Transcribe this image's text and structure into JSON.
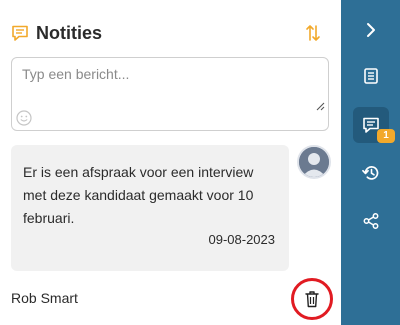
{
  "header": {
    "title": "Notities",
    "title_icon": "note-icon",
    "sort_icon": "sort-arrows-icon"
  },
  "compose": {
    "placeholder": "Typ een bericht...",
    "value": "",
    "emoji_icon": "smiley-icon"
  },
  "notes": [
    {
      "text": "Er is een afspraak voor een interview met deze kandidaat gemaakt voor 10 februari.",
      "date": "09-08-2023",
      "author": "Rob Smart",
      "avatar_icon": "user-avatar-icon",
      "delete_icon": "trash-icon"
    }
  ],
  "sidebar": {
    "items": [
      {
        "icon": "chevron-right-icon",
        "active": false
      },
      {
        "icon": "document-icon",
        "active": false
      },
      {
        "icon": "notes-icon",
        "active": true,
        "badge": "1"
      },
      {
        "icon": "history-icon",
        "active": false
      },
      {
        "icon": "share-icon",
        "active": false
      }
    ]
  },
  "colors": {
    "accent": "#f2a92b",
    "sidebar": "#2e6f96",
    "sidebar_active": "#235a7c",
    "highlight_ring": "#e11b22",
    "note_bg": "#f1f1f1"
  }
}
